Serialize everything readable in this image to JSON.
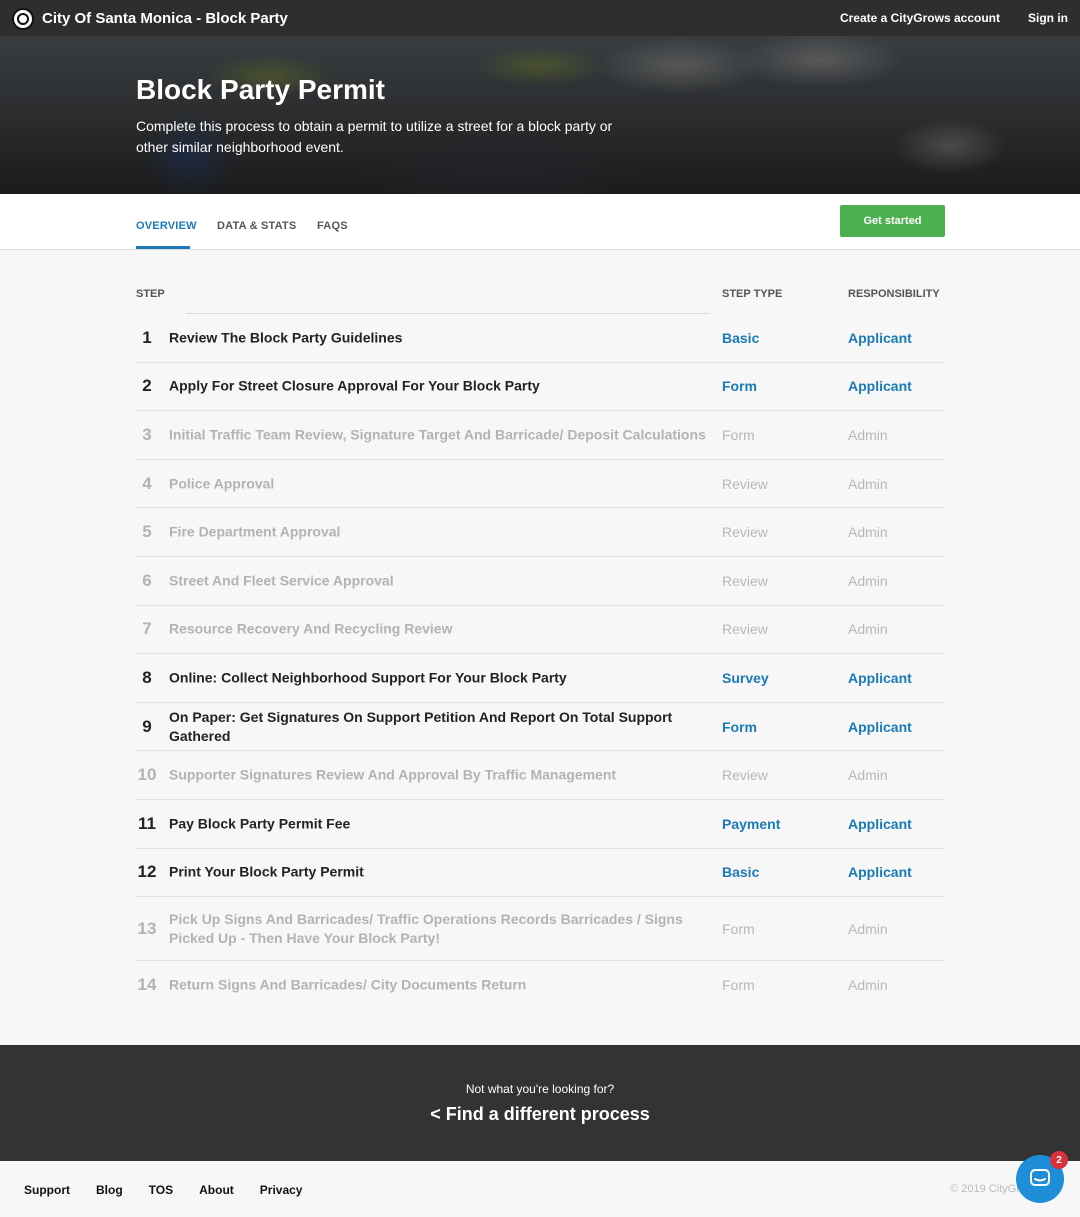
{
  "header": {
    "site_title": "City Of Santa Monica - Block Party",
    "create_account": "Create a CityGrows account",
    "sign_in": "Sign in"
  },
  "hero": {
    "title": "Block Party Permit",
    "description": "Complete this process to obtain a permit to utilize a street for a block party or other similar neighborhood event."
  },
  "tabs": [
    {
      "label": "OVERVIEW",
      "active": true
    },
    {
      "label": "DATA & STATS",
      "active": false
    },
    {
      "label": "FAQS",
      "active": false
    }
  ],
  "cta": {
    "get_started": "Get started"
  },
  "table": {
    "headers": {
      "step": "STEP",
      "step_type": "STEP TYPE",
      "responsibility": "RESPONSIBILITY"
    },
    "rows": [
      {
        "num": "1",
        "title": "Review The Block Party Guidelines",
        "type": "Basic",
        "resp": "Applicant",
        "active": true
      },
      {
        "num": "2",
        "title": "Apply For Street Closure Approval For Your Block Party",
        "type": "Form",
        "resp": "Applicant",
        "active": true
      },
      {
        "num": "3",
        "title": "Initial Traffic Team Review, Signature Target And Barricade/ Deposit Calculations",
        "type": "Form",
        "resp": "Admin",
        "active": false
      },
      {
        "num": "4",
        "title": "Police Approval",
        "type": "Review",
        "resp": "Admin",
        "active": false
      },
      {
        "num": "5",
        "title": "Fire Department Approval",
        "type": "Review",
        "resp": "Admin",
        "active": false
      },
      {
        "num": "6",
        "title": "Street And Fleet Service Approval",
        "type": "Review",
        "resp": "Admin",
        "active": false
      },
      {
        "num": "7",
        "title": "Resource Recovery And Recycling Review",
        "type": "Review",
        "resp": "Admin",
        "active": false
      },
      {
        "num": "8",
        "title": "Online: Collect Neighborhood Support For Your Block Party",
        "type": "Survey",
        "resp": "Applicant",
        "active": true
      },
      {
        "num": "9",
        "title": "On Paper: Get Signatures On Support Petition And Report On Total Support Gathered",
        "type": "Form",
        "resp": "Applicant",
        "active": true
      },
      {
        "num": "10",
        "title": "Supporter Signatures Review And Approval By Traffic Management",
        "type": "Review",
        "resp": "Admin",
        "active": false
      },
      {
        "num": "11",
        "title": "Pay Block Party Permit Fee",
        "type": "Payment",
        "resp": "Applicant",
        "active": true
      },
      {
        "num": "12",
        "title": "Print Your Block Party Permit",
        "type": "Basic",
        "resp": "Applicant",
        "active": true
      },
      {
        "num": "13",
        "title": "Pick Up Signs And Barricades/ Traffic Operations Records Barricades / Signs Picked Up - Then Have Your Block Party!",
        "type": "Form",
        "resp": "Admin",
        "active": false
      },
      {
        "num": "14",
        "title": "Return Signs And Barricades/ City Documents Return",
        "type": "Form",
        "resp": "Admin",
        "active": false
      }
    ]
  },
  "bottom_cta": {
    "question": "Not what you're looking for?",
    "link": "< Find a different process"
  },
  "footer": {
    "links": [
      "Support",
      "Blog",
      "TOS",
      "About",
      "Privacy"
    ],
    "copyright": "© 2019 CityGr"
  },
  "chat": {
    "badge": "2",
    "icon": "chat-bubble-icon"
  },
  "colors": {
    "accent": "#1b7ab8",
    "cta": "#4caf50",
    "topbar": "#2e2e2e",
    "badge": "#d9323a"
  }
}
